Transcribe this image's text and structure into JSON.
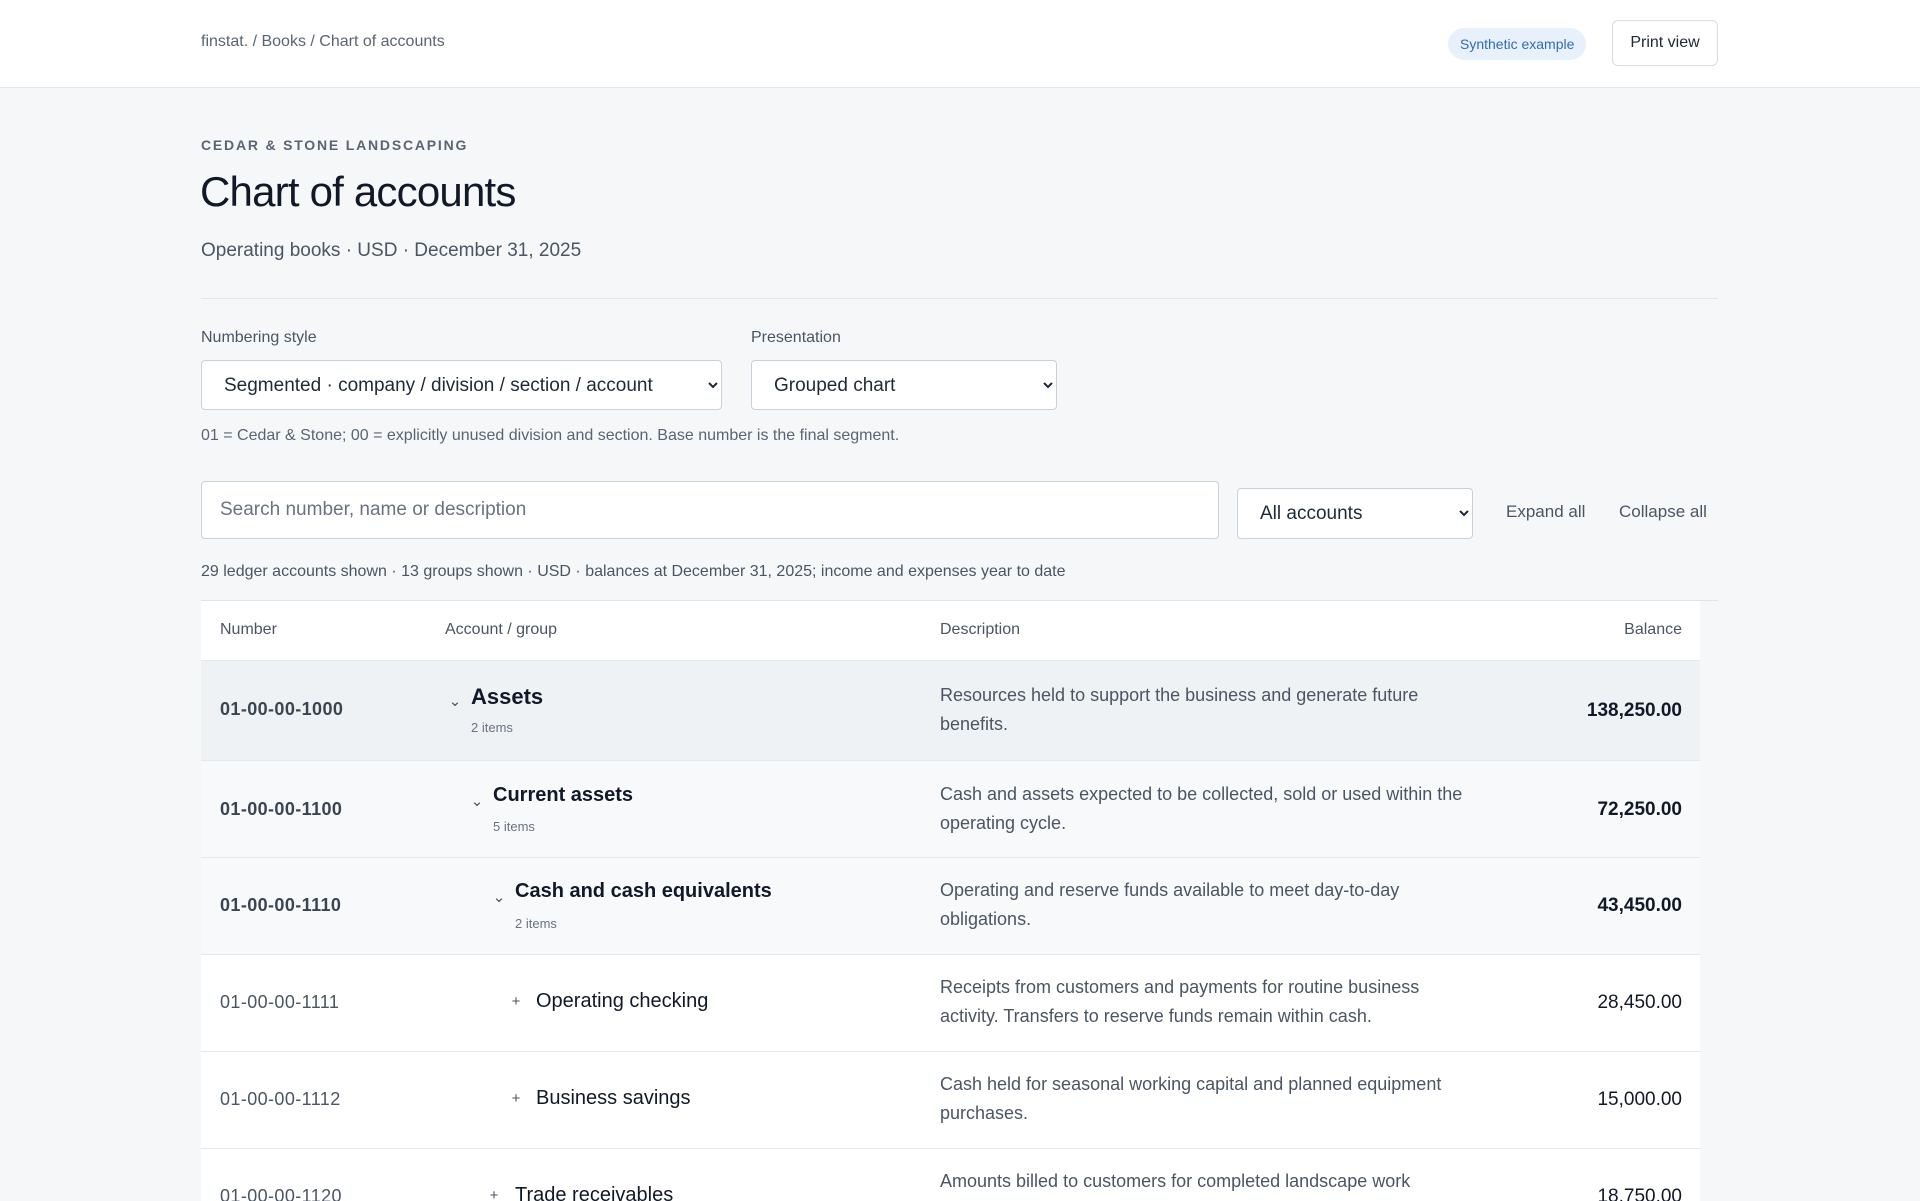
{
  "header": {
    "breadcrumb": [
      "finstat.",
      "Books",
      "Chart of accounts"
    ],
    "badge": "Synthetic example",
    "print_label": "Print view"
  },
  "page": {
    "company": "CEDAR & STONE LANDSCAPING",
    "title": "Chart of accounts",
    "subtitle": "Operating books · USD · December 31, 2025"
  },
  "controls": {
    "numbering_label": "Numbering style",
    "numbering_value": "Segmented · company / division / section / account",
    "presentation_label": "Presentation",
    "presentation_value": "Grouped chart",
    "help": "01 = Cedar & Stone; 00 = explicitly unused division and section. Base number is the final segment.",
    "search_placeholder": "Search number, name or description",
    "filter_value": "All accounts",
    "expand_label": "Expand all",
    "collapse_label": "Collapse all"
  },
  "summary": "29 ledger accounts shown · 13 groups shown · USD · balances at December 31, 2025; income and expenses year to date",
  "table": {
    "columns": [
      "Number",
      "Account / group",
      "Description",
      "Balance"
    ],
    "rows": [
      {
        "number": "01-00-00-1000",
        "name": "Assets",
        "count": "2 items",
        "description": "Resources held to support the business and generate future benefits.",
        "balance": "138,250.00",
        "level": 0,
        "group": true,
        "toggle": "⌄"
      },
      {
        "number": "01-00-00-1100",
        "name": "Current assets",
        "count": "5 items",
        "description": "Cash and assets expected to be collected, sold or used within the operating cycle.",
        "balance": "72,250.00",
        "level": 1,
        "group": true,
        "toggle": "⌄"
      },
      {
        "number": "01-00-00-1110",
        "name": "Cash and cash equivalents",
        "count": "2 items",
        "description": "Operating and reserve funds available to meet day-to-day obligations.",
        "balance": "43,450.00",
        "level": 2,
        "group": true,
        "toggle": "⌄"
      },
      {
        "number": "01-00-00-1111",
        "name": "Operating checking",
        "count": "",
        "description": "Receipts from customers and payments for routine business activity. Transfers to reserve funds remain within cash.",
        "balance": "28,450.00",
        "level": 3,
        "group": false,
        "toggle": "+"
      },
      {
        "number": "01-00-00-1112",
        "name": "Business savings",
        "count": "",
        "description": "Cash held for seasonal working capital and planned equipment purchases.",
        "balance": "15,000.00",
        "level": 3,
        "group": false,
        "toggle": "+"
      },
      {
        "number": "01-00-00-1120",
        "name": "Trade receivables",
        "count": "",
        "description": "Amounts billed to customers for completed landscape work",
        "balance": "18,750.00",
        "level": 2,
        "group": false,
        "toggle": "+"
      }
    ]
  }
}
